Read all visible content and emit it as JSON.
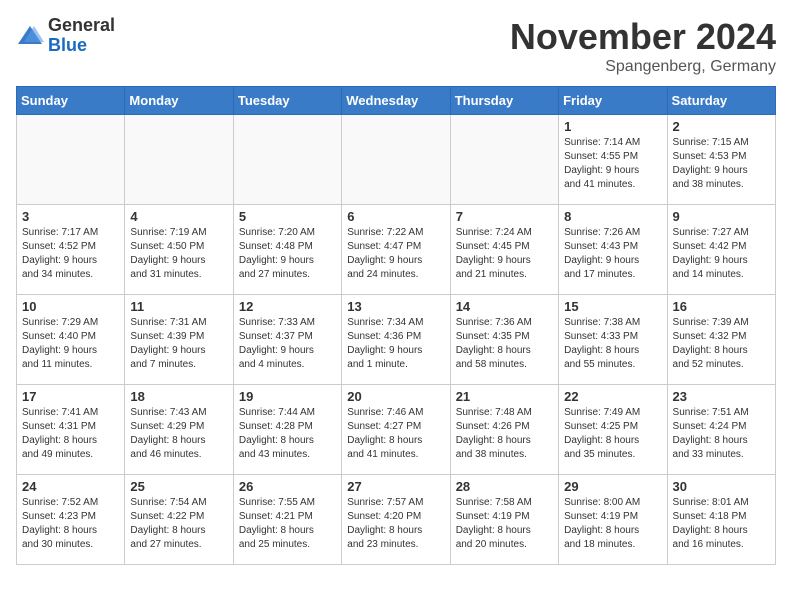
{
  "header": {
    "logo_general": "General",
    "logo_blue": "Blue",
    "month_title": "November 2024",
    "location": "Spangenberg, Germany"
  },
  "weekdays": [
    "Sunday",
    "Monday",
    "Tuesday",
    "Wednesday",
    "Thursday",
    "Friday",
    "Saturday"
  ],
  "weeks": [
    [
      {
        "day": "",
        "info": ""
      },
      {
        "day": "",
        "info": ""
      },
      {
        "day": "",
        "info": ""
      },
      {
        "day": "",
        "info": ""
      },
      {
        "day": "",
        "info": ""
      },
      {
        "day": "1",
        "info": "Sunrise: 7:14 AM\nSunset: 4:55 PM\nDaylight: 9 hours\nand 41 minutes."
      },
      {
        "day": "2",
        "info": "Sunrise: 7:15 AM\nSunset: 4:53 PM\nDaylight: 9 hours\nand 38 minutes."
      }
    ],
    [
      {
        "day": "3",
        "info": "Sunrise: 7:17 AM\nSunset: 4:52 PM\nDaylight: 9 hours\nand 34 minutes."
      },
      {
        "day": "4",
        "info": "Sunrise: 7:19 AM\nSunset: 4:50 PM\nDaylight: 9 hours\nand 31 minutes."
      },
      {
        "day": "5",
        "info": "Sunrise: 7:20 AM\nSunset: 4:48 PM\nDaylight: 9 hours\nand 27 minutes."
      },
      {
        "day": "6",
        "info": "Sunrise: 7:22 AM\nSunset: 4:47 PM\nDaylight: 9 hours\nand 24 minutes."
      },
      {
        "day": "7",
        "info": "Sunrise: 7:24 AM\nSunset: 4:45 PM\nDaylight: 9 hours\nand 21 minutes."
      },
      {
        "day": "8",
        "info": "Sunrise: 7:26 AM\nSunset: 4:43 PM\nDaylight: 9 hours\nand 17 minutes."
      },
      {
        "day": "9",
        "info": "Sunrise: 7:27 AM\nSunset: 4:42 PM\nDaylight: 9 hours\nand 14 minutes."
      }
    ],
    [
      {
        "day": "10",
        "info": "Sunrise: 7:29 AM\nSunset: 4:40 PM\nDaylight: 9 hours\nand 11 minutes."
      },
      {
        "day": "11",
        "info": "Sunrise: 7:31 AM\nSunset: 4:39 PM\nDaylight: 9 hours\nand 7 minutes."
      },
      {
        "day": "12",
        "info": "Sunrise: 7:33 AM\nSunset: 4:37 PM\nDaylight: 9 hours\nand 4 minutes."
      },
      {
        "day": "13",
        "info": "Sunrise: 7:34 AM\nSunset: 4:36 PM\nDaylight: 9 hours\nand 1 minute."
      },
      {
        "day": "14",
        "info": "Sunrise: 7:36 AM\nSunset: 4:35 PM\nDaylight: 8 hours\nand 58 minutes."
      },
      {
        "day": "15",
        "info": "Sunrise: 7:38 AM\nSunset: 4:33 PM\nDaylight: 8 hours\nand 55 minutes."
      },
      {
        "day": "16",
        "info": "Sunrise: 7:39 AM\nSunset: 4:32 PM\nDaylight: 8 hours\nand 52 minutes."
      }
    ],
    [
      {
        "day": "17",
        "info": "Sunrise: 7:41 AM\nSunset: 4:31 PM\nDaylight: 8 hours\nand 49 minutes."
      },
      {
        "day": "18",
        "info": "Sunrise: 7:43 AM\nSunset: 4:29 PM\nDaylight: 8 hours\nand 46 minutes."
      },
      {
        "day": "19",
        "info": "Sunrise: 7:44 AM\nSunset: 4:28 PM\nDaylight: 8 hours\nand 43 minutes."
      },
      {
        "day": "20",
        "info": "Sunrise: 7:46 AM\nSunset: 4:27 PM\nDaylight: 8 hours\nand 41 minutes."
      },
      {
        "day": "21",
        "info": "Sunrise: 7:48 AM\nSunset: 4:26 PM\nDaylight: 8 hours\nand 38 minutes."
      },
      {
        "day": "22",
        "info": "Sunrise: 7:49 AM\nSunset: 4:25 PM\nDaylight: 8 hours\nand 35 minutes."
      },
      {
        "day": "23",
        "info": "Sunrise: 7:51 AM\nSunset: 4:24 PM\nDaylight: 8 hours\nand 33 minutes."
      }
    ],
    [
      {
        "day": "24",
        "info": "Sunrise: 7:52 AM\nSunset: 4:23 PM\nDaylight: 8 hours\nand 30 minutes."
      },
      {
        "day": "25",
        "info": "Sunrise: 7:54 AM\nSunset: 4:22 PM\nDaylight: 8 hours\nand 27 minutes."
      },
      {
        "day": "26",
        "info": "Sunrise: 7:55 AM\nSunset: 4:21 PM\nDaylight: 8 hours\nand 25 minutes."
      },
      {
        "day": "27",
        "info": "Sunrise: 7:57 AM\nSunset: 4:20 PM\nDaylight: 8 hours\nand 23 minutes."
      },
      {
        "day": "28",
        "info": "Sunrise: 7:58 AM\nSunset: 4:19 PM\nDaylight: 8 hours\nand 20 minutes."
      },
      {
        "day": "29",
        "info": "Sunrise: 8:00 AM\nSunset: 4:19 PM\nDaylight: 8 hours\nand 18 minutes."
      },
      {
        "day": "30",
        "info": "Sunrise: 8:01 AM\nSunset: 4:18 PM\nDaylight: 8 hours\nand 16 minutes."
      }
    ]
  ]
}
